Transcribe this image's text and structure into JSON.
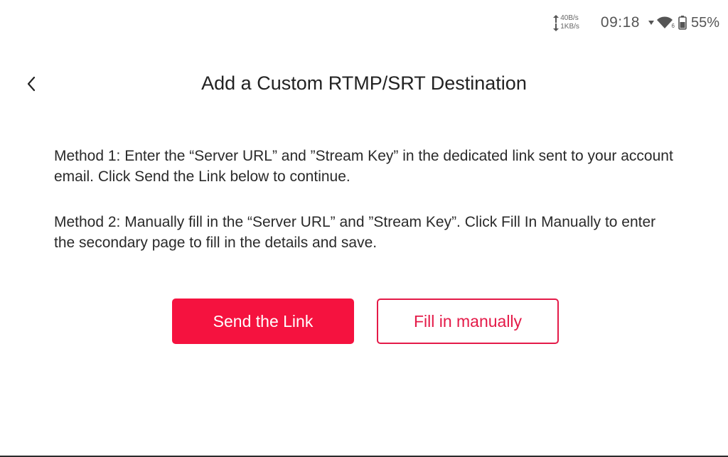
{
  "status_bar": {
    "upload_speed": "40B/s",
    "download_speed": "1KB/s",
    "time": "09:18",
    "wifi_badge": "6",
    "battery": "55%",
    "icons": [
      "arrow-up-icon",
      "arrow-down-icon",
      "signal-dropdown-icon",
      "wifi-icon",
      "battery-icon"
    ]
  },
  "header": {
    "title": "Add a Custom RTMP/SRT Destination",
    "back_icon": "chevron-left-icon"
  },
  "content": {
    "method_1": "Method 1: Enter the “Server URL” and ”Stream Key” in the dedicated link sent to your account email. Click Send the Link below to continue.",
    "method_2": "Method 2: Manually fill in the “Server URL” and ”Stream Key”. Click Fill In Manually to enter the secondary page to fill in the details and save."
  },
  "buttons": {
    "send_link_label": "Send the Link",
    "fill_manually_label": "Fill in manually"
  },
  "colors": {
    "primary": "#f5123f",
    "outline": "#e41a48",
    "text": "#222222",
    "background": "#ffffff"
  }
}
